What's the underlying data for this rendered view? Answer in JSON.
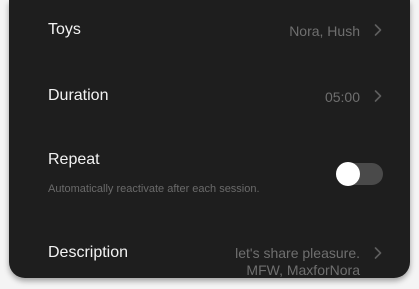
{
  "settings": {
    "toys": {
      "label": "Toys",
      "value": "Nora, Hush",
      "chevron_icon": "chevron-right-icon"
    },
    "duration": {
      "label": "Duration",
      "value": "05:00",
      "chevron_icon": "chevron-right-icon"
    },
    "repeat": {
      "label": "Repeat",
      "sublabel": "Automatically reactivate after each session.",
      "toggle_state": "off"
    },
    "description": {
      "label": "Description",
      "value_line1": "let's share pleasure.",
      "value_line2": "MFW, MaxforNora",
      "chevron_icon": "chevron-right-icon"
    }
  },
  "colors": {
    "panel_background": "#1e1e1e",
    "label_text": "#f2f2f2",
    "value_text": "#6f6f6f",
    "toggle_track": "#4a4a4a",
    "toggle_knob": "#ffffff"
  }
}
